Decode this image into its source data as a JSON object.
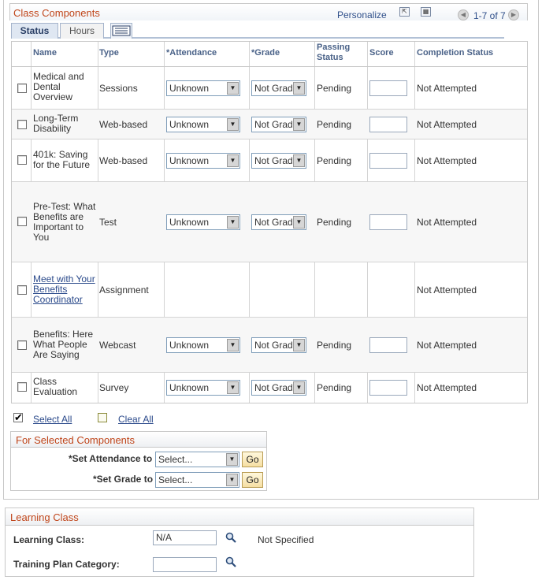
{
  "class_components": {
    "title": "Class Components",
    "personalize": "Personalize",
    "page_count": "1-7 of 7",
    "tabs": [
      {
        "label": "Status"
      },
      {
        "label": "Hours"
      }
    ],
    "icons": {
      "zoom": "view-all-icon",
      "download": "spreadsheet-download-icon",
      "first": "first-page-icon",
      "last": "last-page-icon",
      "show_all_columns": "show-all-columns-icon"
    },
    "columns": {
      "name": "Name",
      "type": "Type",
      "attendance": "*Attendance",
      "grade": "*Grade",
      "passing_status": "Passing Status",
      "score": "Score",
      "completion_status": "Completion Status"
    },
    "rows": [
      {
        "name": "Medical and Dental Overview",
        "type": "Sessions",
        "attendance": "Unknown",
        "grade": "Not Grad",
        "passing": "Pending",
        "completion": "Not Attempted"
      },
      {
        "name": "Long-Term Disability",
        "type": "Web-based",
        "attendance": "Unknown",
        "grade": "Not Grad",
        "passing": "Pending",
        "completion": "Not Attempted"
      },
      {
        "name": "401k: Saving for the Future",
        "type": "Web-based",
        "attendance": "Unknown",
        "grade": "Not Grad",
        "passing": "Pending",
        "completion": "Not Attempted"
      },
      {
        "name": "Pre-Test: What Benefits are Important to You",
        "type": "Test",
        "attendance": "Unknown",
        "grade": "Not Grad",
        "passing": "Pending",
        "completion": "Not Attempted"
      },
      {
        "name": "Meet with Your Benefits Coordinator",
        "type": "Assignment",
        "completion": "Not Attempted"
      },
      {
        "name": "Benefits: Here What People Are Saying",
        "type": "Webcast",
        "attendance": "Unknown",
        "grade": "Not Grad",
        "passing": "Pending",
        "completion": "Not Attempted"
      },
      {
        "name": "Class Evaluation",
        "type": "Survey",
        "attendance": "Unknown",
        "grade": "Not Grad",
        "passing": "Pending",
        "completion": "Not Attempted"
      }
    ],
    "select_all": "Select All",
    "clear_all": "Clear All"
  },
  "selected_components": {
    "title": "For Selected Components",
    "set_attendance_label": "*Set Attendance to",
    "set_grade_label": "*Set Grade to",
    "attendance_value": "Select...",
    "grade_value": "Select...",
    "go_label": "Go"
  },
  "learning_class": {
    "title": "Learning Class",
    "class_label": "Learning Class:",
    "class_value": "N/A",
    "class_description": "Not Specified",
    "category_label": "Training Plan Category:",
    "category_value": ""
  },
  "colors": {
    "section_title": "#c0461b",
    "link": "#2b4a8b",
    "header_text": "#4a6288"
  }
}
